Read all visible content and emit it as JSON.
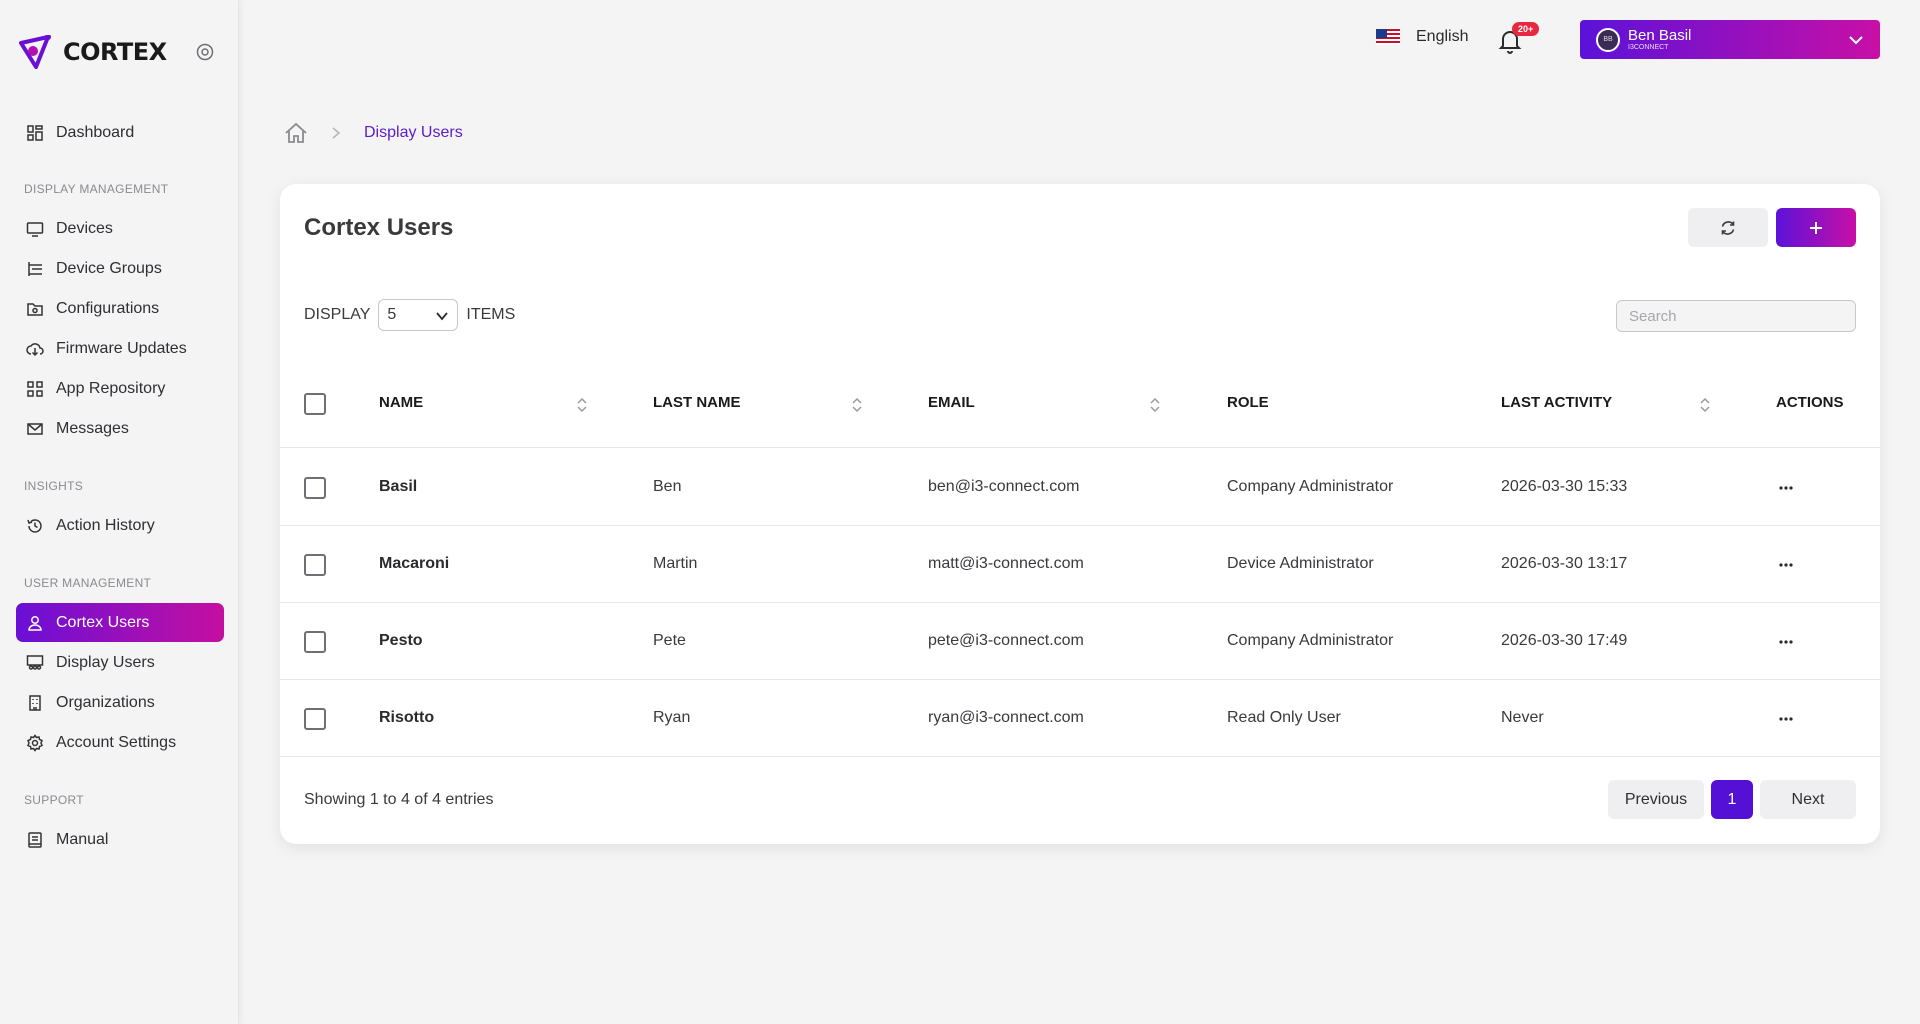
{
  "brand": {
    "name": "CORTEX"
  },
  "sidebar": {
    "items": [
      {
        "label": "Dashboard",
        "icon": "dashboard-icon"
      },
      {
        "section": "DISPLAY MANAGEMENT"
      },
      {
        "label": "Devices",
        "icon": "monitor-icon"
      },
      {
        "label": "Device Groups",
        "icon": "hierarchy-icon"
      },
      {
        "label": "Configurations",
        "icon": "folder-gear-icon"
      },
      {
        "label": "Firmware Updates",
        "icon": "cloud-download-icon"
      },
      {
        "label": "App Repository",
        "icon": "apps-grid-icon"
      },
      {
        "label": "Messages",
        "icon": "envelope-icon"
      },
      {
        "section": "INSIGHTS"
      },
      {
        "label": "Action History",
        "icon": "history-icon"
      },
      {
        "section": "USER MANAGEMENT"
      },
      {
        "label": "Cortex Users",
        "icon": "user-icon",
        "active": true
      },
      {
        "label": "Display Users",
        "icon": "display-users-icon"
      },
      {
        "label": "Organizations",
        "icon": "building-icon"
      },
      {
        "label": "Account Settings",
        "icon": "gear-icon"
      },
      {
        "section": "SUPPORT"
      },
      {
        "label": "Manual",
        "icon": "book-icon"
      }
    ]
  },
  "header": {
    "language": "English",
    "notifications_badge": "20+",
    "user": {
      "name": "Ben Basil",
      "org": "I3CONNECT",
      "initials": "BB"
    }
  },
  "breadcrumb": {
    "current": "Display Users"
  },
  "card": {
    "title": "Cortex Users",
    "display_label": "DISPLAY",
    "display_value": "5",
    "items_label": "ITEMS",
    "search_placeholder": "Search"
  },
  "table": {
    "columns": [
      "NAME",
      "LAST NAME",
      "EMAIL",
      "ROLE",
      "LAST ACTIVITY",
      "ACTIONS"
    ],
    "rows": [
      {
        "name": "Basil",
        "last_name": "Ben",
        "email": "ben@i3-connect.com",
        "role": "Company Administrator",
        "last_activity": "2026-03-30 15:33"
      },
      {
        "name": "Macaroni",
        "last_name": "Martin",
        "email": "matt@i3-connect.com",
        "role": "Device Administrator",
        "last_activity": "2026-03-30 13:17"
      },
      {
        "name": "Pesto",
        "last_name": "Pete",
        "email": "pete@i3-connect.com",
        "role": "Company Administrator",
        "last_activity": "2026-03-30 17:49"
      },
      {
        "name": "Risotto",
        "last_name": "Ryan",
        "email": "ryan@i3-connect.com",
        "role": "Read Only User",
        "last_activity": "Never"
      }
    ]
  },
  "pagination": {
    "summary": "Showing 1 to 4 of 4 entries",
    "previous": "Previous",
    "current_page": "1",
    "next": "Next"
  },
  "colors": {
    "accent": "#5510d6",
    "accent_gradient_end": "#c80fa6",
    "badge": "#e8283f"
  }
}
